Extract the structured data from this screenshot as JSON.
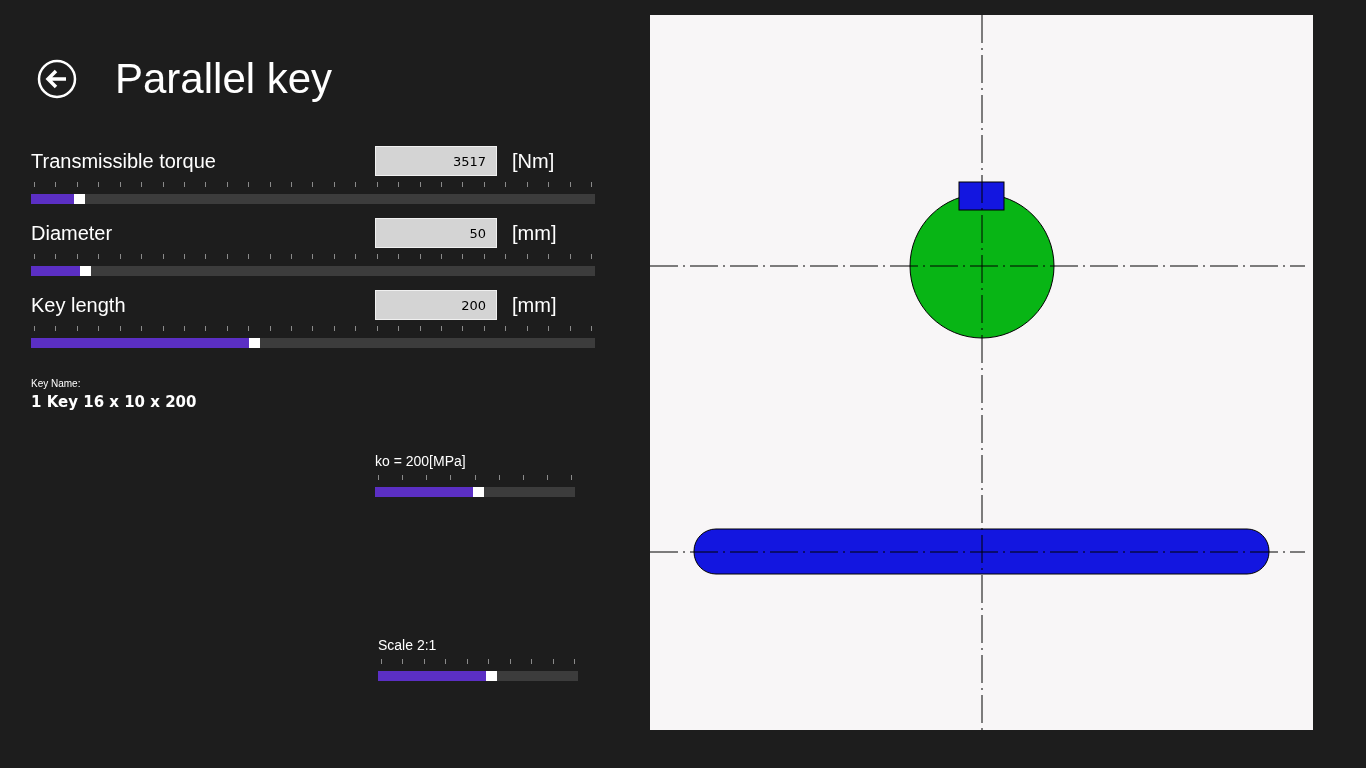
{
  "header": {
    "title": "Parallel key"
  },
  "inputs": [
    {
      "label": "Transmissible torque",
      "value": "3517",
      "unit": "[Nm]",
      "level": 0.08
    },
    {
      "label": "Diameter",
      "value": "50",
      "unit": "[mm]",
      "level": 0.09
    },
    {
      "label": "Key length",
      "value": "200",
      "unit": "[mm]",
      "level": 0.39
    }
  ],
  "result": {
    "label": "Key Name:",
    "value": "1 Key 16 x 10 x 200"
  },
  "settings": [
    {
      "label": "ko = 200[MPa]",
      "level": 0.5
    },
    {
      "label": "Scale 2:1",
      "level": 0.55
    }
  ]
}
